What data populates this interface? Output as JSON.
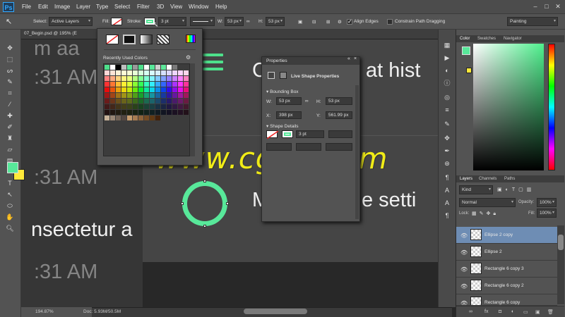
{
  "app": {
    "logo": "Ps"
  },
  "menubar": {
    "items": [
      "File",
      "Edit",
      "Image",
      "Layer",
      "Type",
      "Select",
      "Filter",
      "3D",
      "View",
      "Window",
      "Help"
    ],
    "window_controls": [
      "–",
      "□",
      "✕"
    ]
  },
  "options_bar": {
    "select_label": "Select:",
    "select_value": "Active Layers",
    "fill_label": "Fill:",
    "stroke_label": "Stroke:",
    "stroke_width": "3 pt",
    "w_label": "W:",
    "w_value": "53 px",
    "h_label": "H:",
    "h_value": "53 px",
    "align_edges": "Align Edges",
    "constrain_path": "Constrain Path Dragging",
    "workspace": "Painting",
    "colors": {
      "stroke": "#58e89a"
    }
  },
  "document": {
    "tab_title": "07_Begin.psd @ 195% (E",
    "zoom": "194.87%",
    "doc_info": "Doc: 5.93M/50.5M"
  },
  "canvas": {
    "texts": [
      "m aa",
      ":31 AM",
      "C",
      "at hist",
      ":31 AM",
      "M",
      "e setti",
      "nsectetur a",
      ":31 AM"
    ],
    "watermark": "www.cgtsj.com",
    "colors": {
      "shape": "#58e89a",
      "watermark": "#f1ec17"
    }
  },
  "swatch_picker": {
    "recent_label": "Recently Used Colors",
    "recent_colors": [
      "#4ee08b",
      "#ffffff",
      "#000000",
      "#bfbfbf",
      "#58e89a",
      "#9a9a9a",
      "#4ee08b",
      "#ffffff",
      "#58e89a",
      "#cfcfcf",
      "#5fe89a",
      "#ffffff",
      "#7a7a7a"
    ]
  },
  "properties": {
    "title": "Properties",
    "header": "Live Shape Properties",
    "bounding_box_label": "Bounding Box",
    "w_label": "W:",
    "w_value": "53 px",
    "h_label": "H:",
    "h_value": "53 px",
    "x_label": "X:",
    "x_value": "398 px",
    "y_label": "Y:",
    "y_value": "561.99 px",
    "shape_details_label": "Shape Details",
    "stroke_width": "3 pt"
  },
  "color_panel": {
    "tabs": [
      "Color",
      "Swatches",
      "Navigator"
    ],
    "fg": "#58e89a",
    "bg": "#ffe93a"
  },
  "layers_panel": {
    "tabs": [
      "Layers",
      "Channels",
      "Paths"
    ],
    "kind": "Kind",
    "blend_mode": "Normal",
    "opacity_label": "Opacity:",
    "opacity_value": "100%",
    "lock_label": "Lock:",
    "fill_label": "Fill:",
    "fill_value": "100%",
    "layers": [
      {
        "name": "Ellipse 2 copy",
        "selected": true
      },
      {
        "name": "Ellipse 2",
        "selected": false
      },
      {
        "name": "Rectangle 6 copy 3",
        "selected": false
      },
      {
        "name": "Rectangle 6 copy 2",
        "selected": false
      },
      {
        "name": "Rectangle 6 copy",
        "selected": false
      }
    ],
    "footer_icons": [
      "link-icon",
      "fx-icon",
      "mask-icon",
      "adjustment-icon",
      "folder-icon",
      "new-layer-icon",
      "trash-icon"
    ]
  }
}
